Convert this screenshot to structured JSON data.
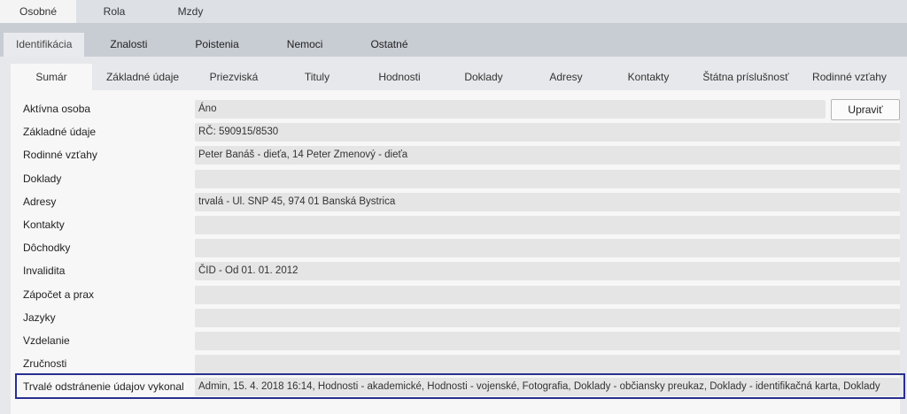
{
  "top_tabs": [
    "Osobné",
    "Rola",
    "Mzdy"
  ],
  "second_tabs": [
    "Identifikácia",
    "Znalosti",
    "Poistenia",
    "Nemoci",
    "Ostatné"
  ],
  "third_tabs": [
    "Sumár",
    "Základné údaje",
    "Priezviská",
    "Tituly",
    "Hodnosti",
    "Doklady",
    "Adresy",
    "Kontakty",
    "Štátna príslušnosť",
    "Rodinné vzťahy"
  ],
  "edit_button": "Upraviť",
  "rows": [
    {
      "label": "Aktívna osoba",
      "value": "Áno"
    },
    {
      "label": "Základné údaje",
      "value": "RČ: 590915/8530"
    },
    {
      "label": "Rodinné vzťahy",
      "value": "Peter Banáš - dieťa, 14 Peter Zmenový - dieťa"
    },
    {
      "label": "Doklady",
      "value": ""
    },
    {
      "label": "Adresy",
      "value": "trvalá - Ul. SNP 45, 974 01 Banská Bystrica"
    },
    {
      "label": "Kontakty",
      "value": ""
    },
    {
      "label": "Dôchodky",
      "value": ""
    },
    {
      "label": "Invalidita",
      "value": "ČID - Od 01. 01. 2012"
    },
    {
      "label": "Zápočet a prax",
      "value": ""
    },
    {
      "label": "Jazyky",
      "value": ""
    },
    {
      "label": "Vzdelanie",
      "value": ""
    },
    {
      "label": "Zručnosti",
      "value": ""
    },
    {
      "label": "Trvalé odstránenie údajov vykonal",
      "value": "Admin, 15. 4. 2018 16:14, Hodnosti - akademické, Hodnosti - vojenské, Fotografia, Doklady - občiansky preukaz, Doklady - identifikačná karta, Doklady"
    }
  ]
}
